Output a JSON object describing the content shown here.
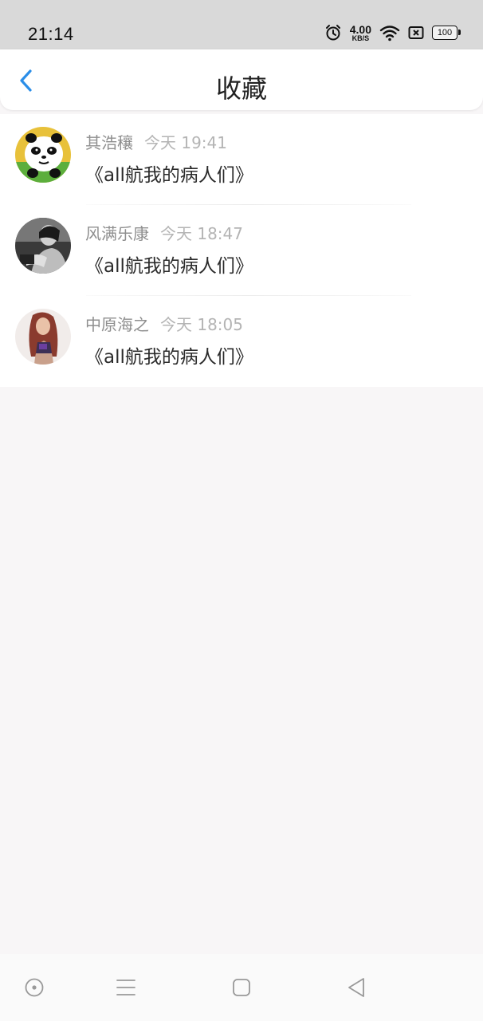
{
  "status_bar": {
    "time": "21:14",
    "net_speed_value": "4.00",
    "net_speed_unit": "KB/S",
    "battery": "100",
    "icons": [
      "alarm-icon",
      "wifi-icon",
      "close-box-icon",
      "battery-icon"
    ]
  },
  "header": {
    "title": "收藏",
    "back_icon": "chevron-left-icon",
    "accent_color": "#2b8ee8"
  },
  "favorites": [
    {
      "author": "其浩穰",
      "time": "今天 19:41",
      "title": "《all航我的病人们》",
      "avatar": "panda-avatar"
    },
    {
      "author": "风满乐康",
      "time": "今天 18:47",
      "title": "《all航我的病人们》",
      "avatar": "bw-photo-avatar"
    },
    {
      "author": "中原海之",
      "time": "今天 18:05",
      "title": "《all航我的病人们》",
      "avatar": "girl-photo-avatar"
    }
  ],
  "nav_bar": {
    "icons": [
      "home-circle-icon",
      "menu-icon",
      "square-icon",
      "back-triangle-icon"
    ]
  }
}
